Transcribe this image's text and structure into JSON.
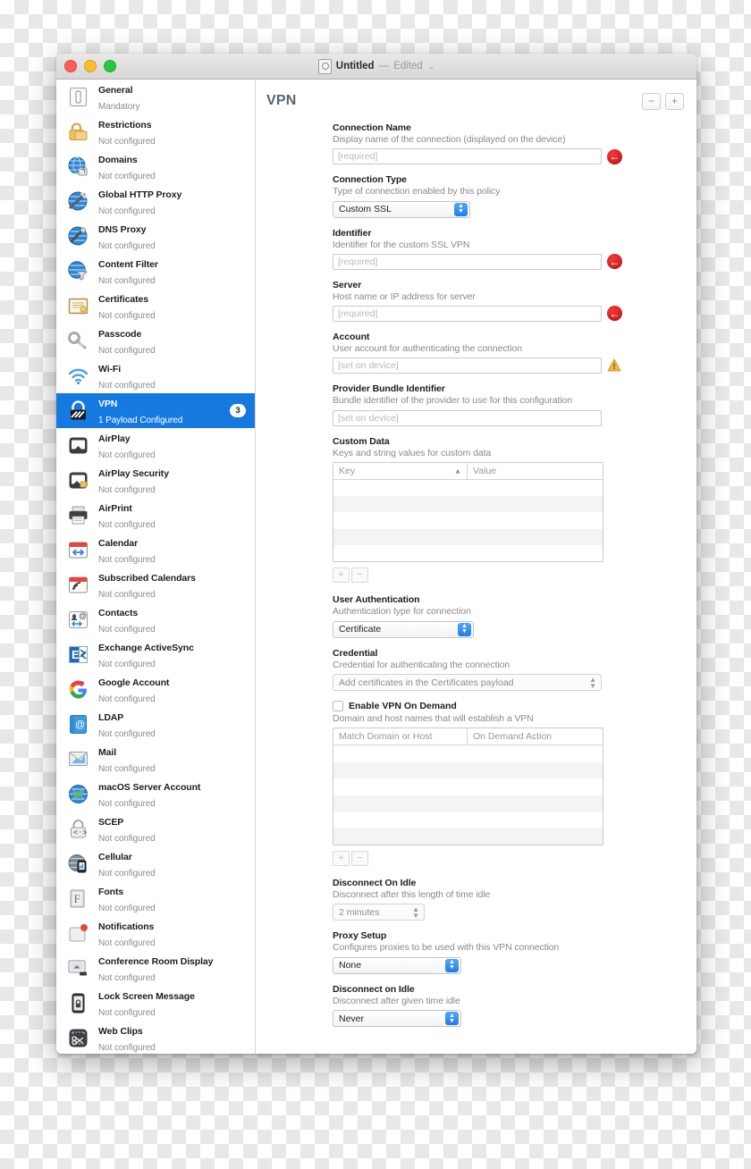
{
  "window": {
    "title": "Untitled",
    "separator": "—",
    "edited_label": "Edited",
    "chevron": "⌄",
    "doc_icon": "document-icon"
  },
  "sidebar": {
    "items": [
      {
        "label": "General",
        "status": "Mandatory",
        "icon": "general-icon"
      },
      {
        "label": "Restrictions",
        "status": "Not configured",
        "icon": "restrictions-lock-icon"
      },
      {
        "label": "Domains",
        "status": "Not configured",
        "icon": "domains-globe-icon"
      },
      {
        "label": "Global HTTP Proxy",
        "status": "Not configured",
        "icon": "global-http-proxy-icon"
      },
      {
        "label": "DNS Proxy",
        "status": "Not configured",
        "icon": "dns-proxy-icon"
      },
      {
        "label": "Content Filter",
        "status": "Not configured",
        "icon": "content-filter-icon"
      },
      {
        "label": "Certificates",
        "status": "Not configured",
        "icon": "certificate-icon"
      },
      {
        "label": "Passcode",
        "status": "Not configured",
        "icon": "passcode-key-icon"
      },
      {
        "label": "Wi-Fi",
        "status": "Not configured",
        "icon": "wifi-icon"
      },
      {
        "label": "VPN",
        "status": "1 Payload Configured",
        "icon": "vpn-lock-icon",
        "badge": "3",
        "selected": true
      },
      {
        "label": "AirPlay",
        "status": "Not configured",
        "icon": "airplay-icon"
      },
      {
        "label": "AirPlay Security",
        "status": "Not configured",
        "icon": "airplay-security-icon"
      },
      {
        "label": "AirPrint",
        "status": "Not configured",
        "icon": "airprint-printer-icon"
      },
      {
        "label": "Calendar",
        "status": "Not configured",
        "icon": "calendar-icon"
      },
      {
        "label": "Subscribed Calendars",
        "status": "Not configured",
        "icon": "subscribed-calendars-icon"
      },
      {
        "label": "Contacts",
        "status": "Not configured",
        "icon": "contacts-icon"
      },
      {
        "label": "Exchange ActiveSync",
        "status": "Not configured",
        "icon": "exchange-activesync-icon"
      },
      {
        "label": "Google Account",
        "status": "Not configured",
        "icon": "google-account-icon"
      },
      {
        "label": "LDAP",
        "status": "Not configured",
        "icon": "ldap-icon"
      },
      {
        "label": "Mail",
        "status": "Not configured",
        "icon": "mail-icon"
      },
      {
        "label": "macOS Server Account",
        "status": "Not configured",
        "icon": "macos-server-account-icon"
      },
      {
        "label": "SCEP",
        "status": "Not configured",
        "icon": "scep-icon"
      },
      {
        "label": "Cellular",
        "status": "Not configured",
        "icon": "cellular-icon"
      },
      {
        "label": "Fonts",
        "status": "Not configured",
        "icon": "fonts-icon"
      },
      {
        "label": "Notifications",
        "status": "Not configured",
        "icon": "notifications-icon"
      },
      {
        "label": "Conference Room Display",
        "status": "Not configured",
        "icon": "conference-room-display-icon"
      },
      {
        "label": "Lock Screen Message",
        "status": "Not configured",
        "icon": "lock-screen-message-icon"
      },
      {
        "label": "Web Clips",
        "status": "Not configured",
        "icon": "web-clips-icon"
      }
    ]
  },
  "detail": {
    "title": "VPN",
    "remove_button": "−",
    "add_button": "+",
    "fields": {
      "connection_name": {
        "label": "Connection Name",
        "desc": "Display name of the connection (displayed on the device)",
        "placeholder": "[required]",
        "value": "",
        "badge": "error"
      },
      "connection_type": {
        "label": "Connection Type",
        "desc": "Type of connection enabled by this policy",
        "value": "Custom SSL"
      },
      "identifier": {
        "label": "Identifier",
        "desc": "Identifier for the custom SSL VPN",
        "placeholder": "[required]",
        "value": "",
        "badge": "error"
      },
      "server": {
        "label": "Server",
        "desc": "Host name or IP address for server",
        "placeholder": "[required]",
        "value": "",
        "badge": "error"
      },
      "account": {
        "label": "Account",
        "desc": "User account for authenticating the connection",
        "placeholder": "[set on device]",
        "value": "",
        "badge": "warning"
      },
      "provider_bundle_identifier": {
        "label": "Provider Bundle Identifier",
        "desc": "Bundle identifier of the provider to use for this configuration",
        "placeholder": "[set on device]",
        "value": ""
      },
      "custom_data": {
        "label": "Custom Data",
        "desc": "Keys and string values for custom data",
        "columns": [
          "Key",
          "Value"
        ],
        "sort_indicator": "▲",
        "rows": [],
        "row_count": 5,
        "add_button": "+",
        "remove_button": "−"
      },
      "user_authentication": {
        "label": "User Authentication",
        "desc": "Authentication type for connection",
        "value": "Certificate"
      },
      "credential": {
        "label": "Credential",
        "desc": "Credential for authenticating the connection",
        "value": "Add certificates in the Certificates payload"
      },
      "enable_vpn_on_demand": {
        "label": "Enable VPN On Demand",
        "checked": false,
        "desc": "Domain and host names that will establish a VPN",
        "columns": [
          "Match Domain or Host",
          "On Demand Action"
        ],
        "rows": [],
        "row_count": 6,
        "add_button": "+",
        "remove_button": "−"
      },
      "disconnect_on_idle_1": {
        "label": "Disconnect On Idle",
        "desc": "Disconnect after this length of time idle",
        "value": "2 minutes"
      },
      "proxy_setup": {
        "label": "Proxy Setup",
        "desc": "Configures proxies to be used with this VPN connection",
        "value": "None"
      },
      "disconnect_on_idle_2": {
        "label": "Disconnect on Idle",
        "desc": "Disconnect after given time idle",
        "value": "Never"
      }
    }
  },
  "colors": {
    "selection_blue": "#1679e0",
    "error_red": "#c50f0f",
    "warning_amber": "#e8b33a",
    "pane_title": "#59636f"
  }
}
